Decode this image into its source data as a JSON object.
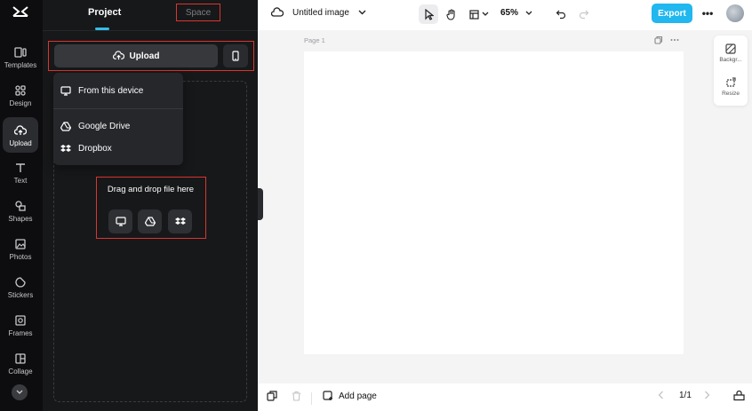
{
  "app": {
    "logo": "capcut-logo"
  },
  "rail": {
    "items": [
      {
        "label": "Templates",
        "icon": "templates-icon"
      },
      {
        "label": "Design",
        "icon": "design-icon"
      },
      {
        "label": "Upload",
        "icon": "cloud-upload-icon",
        "active": true
      },
      {
        "label": "Text",
        "icon": "text-icon"
      },
      {
        "label": "Shapes",
        "icon": "shapes-icon"
      },
      {
        "label": "Photos",
        "icon": "photos-icon"
      },
      {
        "label": "Stickers",
        "icon": "stickers-icon"
      },
      {
        "label": "Frames",
        "icon": "frames-icon"
      },
      {
        "label": "Collage",
        "icon": "collage-icon"
      }
    ],
    "more_icon": "chevron-down-icon"
  },
  "panel": {
    "tabs": [
      {
        "label": "Project",
        "active": true
      },
      {
        "label": "Space",
        "active": false
      }
    ],
    "upload_label": "Upload",
    "menu": {
      "items": [
        {
          "label": "From this device",
          "icon": "monitor-icon"
        },
        {
          "label": "Google Drive",
          "icon": "google-drive-icon"
        },
        {
          "label": "Dropbox",
          "icon": "dropbox-icon"
        }
      ]
    },
    "dropzone_text": "Drag and drop file here"
  },
  "topbar": {
    "title": "Untitled image",
    "zoom": "65%",
    "export_label": "Export",
    "more": "•••"
  },
  "canvas": {
    "page_label": "Page 1"
  },
  "side_tools": [
    {
      "label": "Backgr...",
      "icon": "background-icon"
    },
    {
      "label": "Resize",
      "icon": "resize-icon"
    }
  ],
  "bottombar": {
    "add_page_label": "Add page",
    "page_counter": "1/1"
  },
  "colors": {
    "accent": "#21b7ef",
    "highlight": "#d9352f",
    "panel_bg": "#17181a",
    "rail_bg": "#0d0d0f"
  }
}
